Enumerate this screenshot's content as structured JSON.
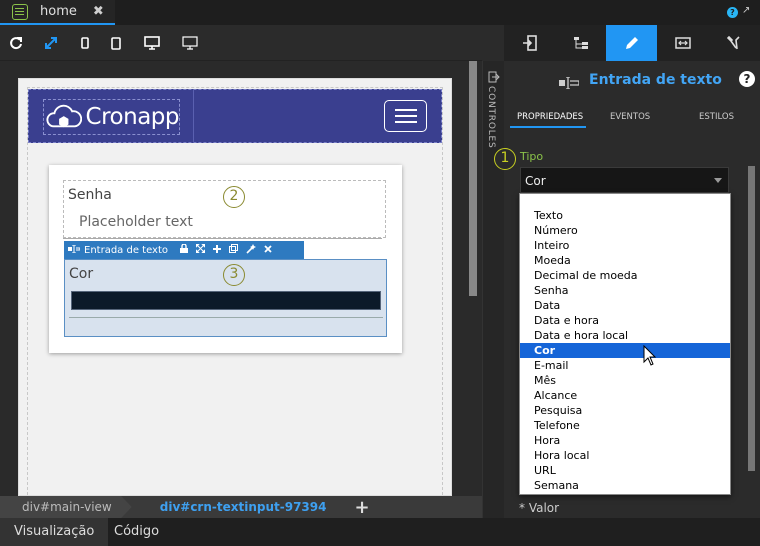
{
  "top_tab": {
    "label": "home",
    "close": "✖"
  },
  "top_icons": {
    "help": "?",
    "expand": "↗"
  },
  "toolbar": {
    "buttons": [
      "refresh-icon",
      "fullscreen-icon",
      "phone-portrait-icon",
      "tablet-icon",
      "desktop-icon",
      "monitor-icon"
    ]
  },
  "canvas": {
    "logo": "Cronapp",
    "badge2": "2",
    "badge3": "3",
    "senha_label": "Senha",
    "senha_placeholder": "Placeholder text",
    "selection_toolbar_label": "Entrada de texto",
    "cor_label": "Cor"
  },
  "breadcrumb": {
    "item1": "div#main-view",
    "item2": "div#crn-textinput-97394",
    "add": "+"
  },
  "bottom_tabs": {
    "tab1": "Visualização",
    "tab2": "Código"
  },
  "controls_label": "CONTROLES",
  "right_panel": {
    "title": "Entrada de texto",
    "help": "?",
    "subtabs": [
      "PROPRIEDADES",
      "EVENTOS",
      "ESTILOS"
    ],
    "badge1": "1",
    "tipo_label": "Tipo",
    "tipo_value": "Cor",
    "valor_label": "* Valor"
  },
  "dropdown": {
    "options": [
      "Texto",
      "Número",
      "Inteiro",
      "Moeda",
      "Decimal de moeda",
      "Senha",
      "Data",
      "Data e hora",
      "Data e hora local",
      "Cor",
      "E-mail",
      "Mês",
      "Alcance",
      "Pesquisa",
      "Telefone",
      "Hora",
      "Hora local",
      "URL",
      "Semana"
    ],
    "selected": "Cor"
  },
  "colors": {
    "accent": "#2196f3",
    "navbar": "#3a3f8f",
    "highlight": "#1565d8",
    "badge": "#c8d022"
  }
}
